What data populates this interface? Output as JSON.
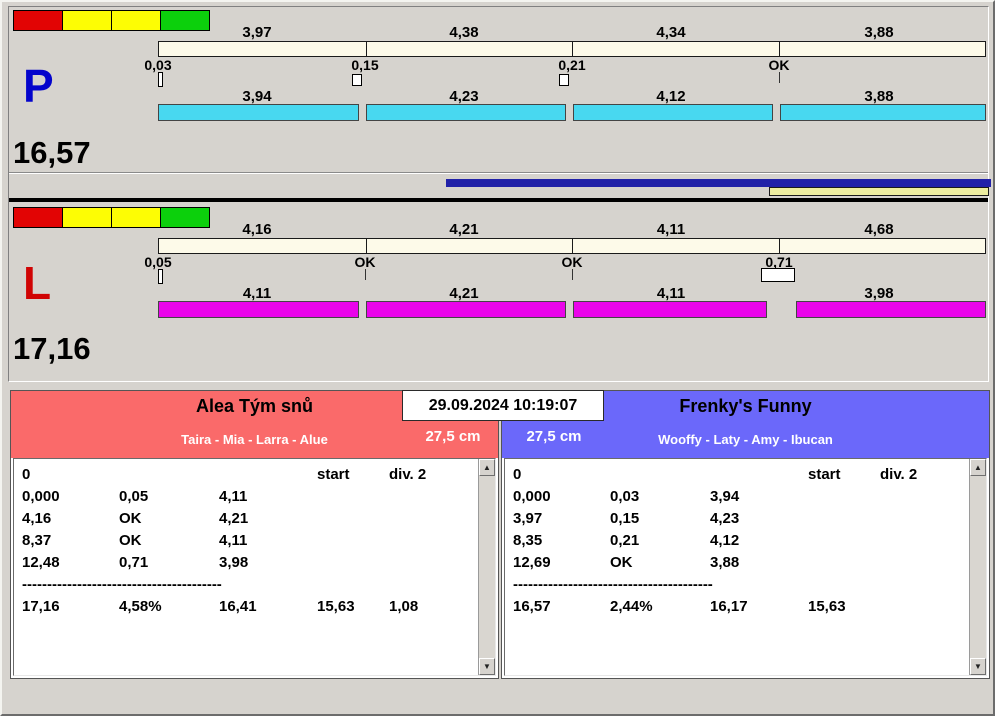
{
  "icons": {
    "scroll_up": "▲",
    "scroll_down": "▼"
  },
  "traffic": {
    "colors": [
      "#e20404",
      "#fdfd04",
      "#fdfd04",
      "#0cd00c"
    ]
  },
  "mid_bars": {
    "blue_color": "#2121a8",
    "yellow_color": "#ededa0"
  },
  "lanes": [
    {
      "label": "P",
      "letter_color": "#0404cc",
      "total": "16,57",
      "bar_color": "#48d8f0",
      "split_labels": [
        "3,97",
        "4,38",
        "4,34",
        "3,88"
      ],
      "markers": [
        {
          "label": "0,03"
        },
        {
          "label": "0,15"
        },
        {
          "label": "0,21"
        },
        {
          "label": "OK"
        }
      ],
      "segment_labels": [
        "3,94",
        "4,23",
        "4,12",
        "3,88"
      ]
    },
    {
      "label": "L",
      "letter_color": "#d00404",
      "total": "17,16",
      "bar_color": "#ea04ea",
      "split_labels": [
        "4,16",
        "4,21",
        "4,11",
        "4,68"
      ],
      "markers": [
        {
          "label": "0,05"
        },
        {
          "label": "OK"
        },
        {
          "label": "OK"
        },
        {
          "label": "0,71"
        }
      ],
      "segment_labels": [
        "4,11",
        "4,21",
        "4,11",
        "3,98"
      ]
    }
  ],
  "datetime": "29.09.2024 10:19:07",
  "teams": [
    {
      "name": "Alea Tým snů",
      "members": "Taira - Mia - Larra - Alue",
      "jump_height": "27,5 cm",
      "header_color": "#fa6a6a",
      "table": {
        "col_zero": "0",
        "start_label": "start",
        "div_label": "div. 2",
        "rows": [
          [
            "0,000",
            "0,05",
            "4,11"
          ],
          [
            "4,16",
            "OK",
            "4,21"
          ],
          [
            "8,37",
            "OK",
            "4,11"
          ],
          [
            "12,48",
            "0,71",
            "3,98"
          ]
        ],
        "separator": "----------------------------------------",
        "totals": [
          "17,16",
          "4,58%",
          "16,41",
          "15,63",
          "1,08"
        ]
      }
    },
    {
      "name": "Frenky's Funny",
      "members": "Wooffy - Laty - Amy - Ibucan",
      "jump_height": "27,5 cm",
      "header_color": "#6b68fa",
      "table": {
        "col_zero": "0",
        "start_label": "start",
        "div_label": "div. 2",
        "rows": [
          [
            "0,000",
            "0,03",
            "3,94"
          ],
          [
            "3,97",
            "0,15",
            "4,23"
          ],
          [
            "8,35",
            "0,21",
            "4,12"
          ],
          [
            "12,69",
            "OK",
            "3,88"
          ]
        ],
        "separator": "----------------------------------------",
        "totals": [
          "16,57",
          "2,44%",
          "16,17",
          "15,63",
          ""
        ]
      }
    }
  ]
}
